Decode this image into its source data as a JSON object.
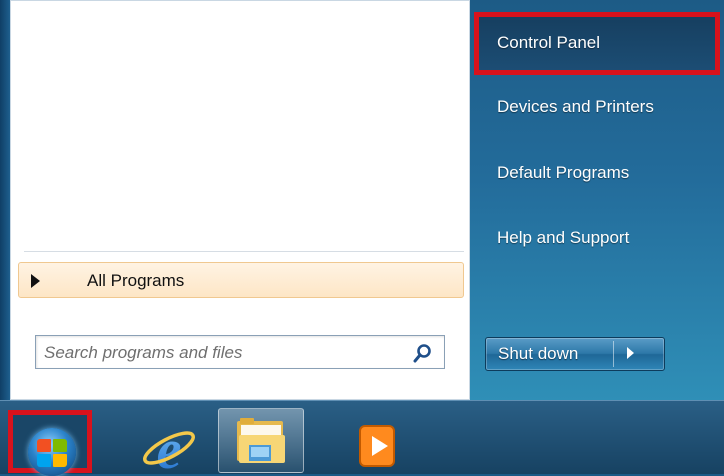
{
  "left_panel": {
    "all_programs_label": "All Programs",
    "search": {
      "placeholder": "Search programs and files",
      "value": ""
    }
  },
  "right_panel": {
    "items": [
      {
        "label": "Control Panel",
        "highlighted": true
      },
      {
        "label": "Devices and Printers"
      },
      {
        "label": "Default Programs"
      },
      {
        "label": "Help and Support"
      }
    ],
    "shutdown_label": "Shut down"
  },
  "taskbar": {
    "icons": [
      "start-orb",
      "internet-explorer-icon",
      "windows-explorer-icon",
      "media-player-icon"
    ]
  },
  "colors": {
    "highlight_border": "#d8121c",
    "right_panel": "#236c9b",
    "all_programs_bg": "#fde6c6"
  }
}
